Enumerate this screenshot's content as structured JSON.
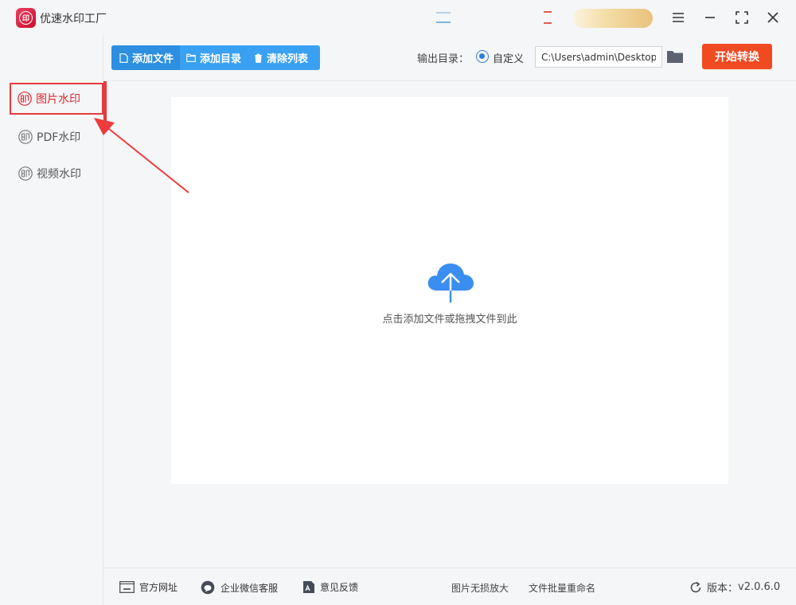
{
  "app": {
    "title": "优速水印工厂",
    "logo_glyph": "印"
  },
  "colors": {
    "accent": "#3aa1f2",
    "active": "#d8282f",
    "start": "#f04a22"
  },
  "sidebar": {
    "items": [
      {
        "label": "图片水印",
        "icon": "watermark-stamp-icon",
        "active": true
      },
      {
        "label": "PDF水印",
        "icon": "watermark-stamp-icon",
        "active": false
      },
      {
        "label": "视频水印",
        "icon": "watermark-stamp-icon",
        "active": false
      }
    ]
  },
  "toolbar": {
    "add_file": "添加文件",
    "add_folder": "添加目录",
    "clear_list": "清除列表",
    "output_label": "输出目录：",
    "radio_custom": "自定义",
    "output_path": "C:\\Users\\admin\\Desktop",
    "start": "开始转换"
  },
  "dropzone": {
    "hint": "点击添加文件或拖拽文件到此"
  },
  "footer": {
    "website": "官方网址",
    "wechat": "企业微信客服",
    "feedback": "意见反馈",
    "image_upscale": "图片无损放大",
    "batch_rename": "文件批量重命名",
    "version_label": "版本：",
    "version": "v2.0.6.0"
  }
}
